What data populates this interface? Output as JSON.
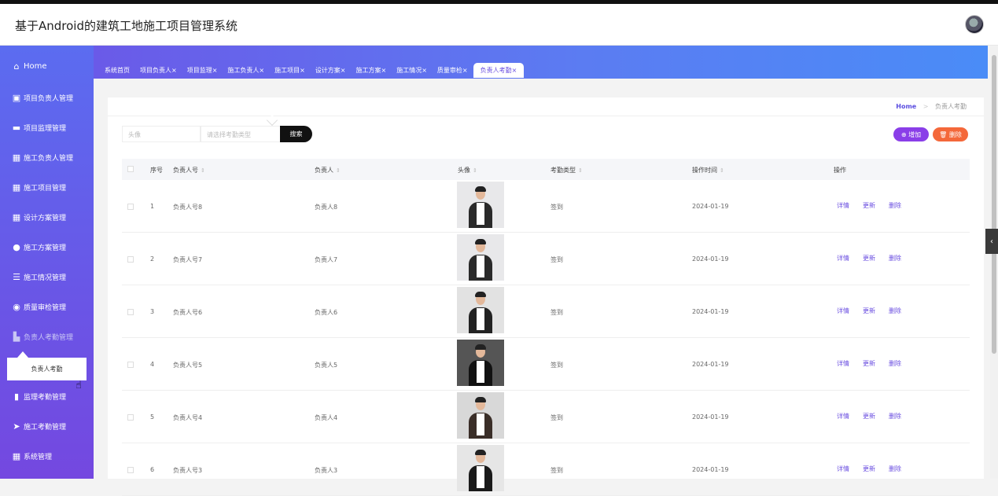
{
  "header": {
    "title": "基于Android的建筑工地施工项目管理系统"
  },
  "sidebar": {
    "items": [
      {
        "label": "Home",
        "icon": "home-icon",
        "glyph": "⌂"
      },
      {
        "label": "项目负责人管理",
        "icon": "clipboard-icon",
        "glyph": "▣"
      },
      {
        "label": "项目监理管理",
        "icon": "briefcase-icon",
        "glyph": "▬"
      },
      {
        "label": "施工负责人管理",
        "icon": "grid-icon",
        "glyph": "▦"
      },
      {
        "label": "施工项目管理",
        "icon": "grid-icon",
        "glyph": "▦"
      },
      {
        "label": "设计方案管理",
        "icon": "grid-icon",
        "glyph": "▦"
      },
      {
        "label": "施工方案管理",
        "icon": "user-icon",
        "glyph": "●"
      },
      {
        "label": "施工情况管理",
        "icon": "list-icon",
        "glyph": "☰"
      },
      {
        "label": "质量审检管理",
        "icon": "lightbulb-icon",
        "glyph": "◉"
      },
      {
        "label": "负责人考勤管理",
        "icon": "building-icon",
        "glyph": "▙"
      },
      {
        "label": "监理考勤管理",
        "icon": "bar-chart-icon",
        "glyph": "▮"
      },
      {
        "label": "施工考勤管理",
        "icon": "paper-plane-icon",
        "glyph": "➤"
      },
      {
        "label": "系统管理",
        "icon": "grid-icon",
        "glyph": "▦"
      }
    ],
    "submenu_label": "负责人考勤"
  },
  "tabs": [
    {
      "label": "系统首页"
    },
    {
      "label": "项目负责人×"
    },
    {
      "label": "项目监理×"
    },
    {
      "label": "施工负责人×"
    },
    {
      "label": "施工项目×"
    },
    {
      "label": "设计方案×"
    },
    {
      "label": "施工方案×"
    },
    {
      "label": "施工情况×"
    },
    {
      "label": "质量审检×"
    },
    {
      "label": "负责人考勤×"
    }
  ],
  "breadcrumb": {
    "home": "Home",
    "sep": ">",
    "current": "负责人考勤"
  },
  "search": {
    "avatar_placeholder": "头像",
    "type_placeholder": "请选择考勤类型",
    "search_label": "搜索"
  },
  "buttons": {
    "add": "⊕ 增加",
    "delete": "🗑 删除"
  },
  "table": {
    "headers": [
      "序号",
      "负责人号",
      "负责人",
      "头像",
      "考勤类型",
      "操作时间",
      "操作"
    ],
    "sort_glyph": "⇕",
    "actions": [
      "详情",
      "更新",
      "删除"
    ],
    "rows": [
      {
        "no": "1",
        "id": "负责人号8",
        "name": "负责人8",
        "type": "签到",
        "time": "2024-01-19"
      },
      {
        "no": "2",
        "id": "负责人号7",
        "name": "负责人7",
        "type": "签到",
        "time": "2024-01-19"
      },
      {
        "no": "3",
        "id": "负责人号6",
        "name": "负责人6",
        "type": "签到",
        "time": "2024-01-19"
      },
      {
        "no": "4",
        "id": "负责人号5",
        "name": "负责人5",
        "type": "签到",
        "time": "2024-01-19"
      },
      {
        "no": "5",
        "id": "负责人号4",
        "name": "负责人4",
        "type": "签到",
        "time": "2024-01-19"
      },
      {
        "no": "6",
        "id": "负责人号3",
        "name": "负责人3",
        "type": "签到",
        "time": "2024-01-19"
      }
    ]
  },
  "colors": {
    "accent": "#6a4ee0",
    "add": "#8a3ee8",
    "delete": "#f4683a",
    "search": "#111111"
  }
}
